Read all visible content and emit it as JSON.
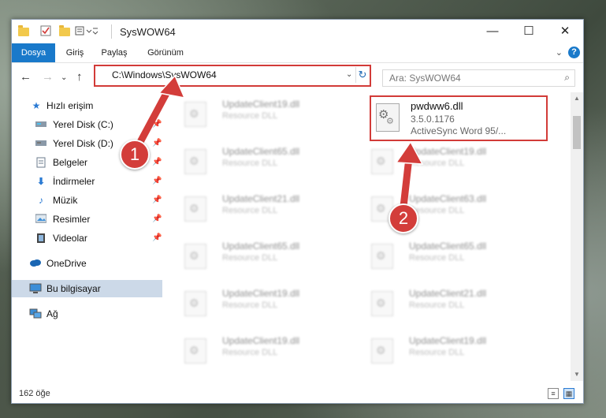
{
  "window": {
    "title": "SysWOW64",
    "controls": {
      "minimize": "—",
      "maximize": "☐",
      "close": "✕"
    }
  },
  "ribbon": {
    "tabs": [
      "Dosya",
      "Giriş",
      "Paylaş",
      "Görünüm"
    ],
    "active_tab": "Dosya",
    "help": "?"
  },
  "address": {
    "path": "C:\\Windows\\SysWOW64",
    "search_placeholder": "Ara: SysWOW64"
  },
  "sidebar": {
    "items": [
      {
        "label": "Hızlı erişim",
        "icon": "star-icon",
        "pinned": false
      },
      {
        "label": "Yerel Disk (C:)",
        "icon": "drive-icon",
        "pinned": true
      },
      {
        "label": "Yerel Disk (D:)",
        "icon": "drive-icon",
        "pinned": true
      },
      {
        "label": "Belgeler",
        "icon": "documents-icon",
        "pinned": true
      },
      {
        "label": "İndirmeler",
        "icon": "download-icon",
        "pinned": true
      },
      {
        "label": "Müzik",
        "icon": "music-icon",
        "pinned": true
      },
      {
        "label": "Resimler",
        "icon": "pictures-icon",
        "pinned": true
      },
      {
        "label": "Videolar",
        "icon": "videos-icon",
        "pinned": true
      },
      {
        "label": "OneDrive",
        "icon": "cloud-icon",
        "pinned": false
      },
      {
        "label": "Bu bilgisayar",
        "icon": "computer-icon",
        "pinned": false,
        "selected": true
      },
      {
        "label": "Ağ",
        "icon": "network-icon",
        "pinned": false
      }
    ]
  },
  "files": {
    "highlighted": {
      "name": "pwdww6.dll",
      "version": "3.5.0.1176",
      "description": "ActiveSync Word 95/..."
    },
    "left_column": [
      {
        "name": "UpdateClient19.dll",
        "type": "Resource DLL"
      },
      {
        "name": "UpdateClient65.dll",
        "type": "Resource DLL"
      },
      {
        "name": "UpdateClient21.dll",
        "type": "Resource DLL"
      },
      {
        "name": "UpdateClient65.dll",
        "type": "Resource DLL"
      },
      {
        "name": "UpdateClient19.dll",
        "type": "Resource DLL"
      },
      {
        "name": "UpdateClient19.dll",
        "type": "Resource DLL"
      }
    ],
    "right_column": [
      {
        "name": "UpdateClient19.dll",
        "type": "Resource DLL"
      },
      {
        "name": "UpdateClient63.dll",
        "type": "Resource DLL"
      },
      {
        "name": "UpdateClient65.dll",
        "type": "Resource DLL"
      },
      {
        "name": "UpdateClient21.dll",
        "type": "Resource DLL"
      },
      {
        "name": "UpdateClient19.dll",
        "type": "Resource DLL"
      }
    ]
  },
  "status": {
    "count": "162 öğe"
  },
  "annotations": {
    "step1": "1",
    "step2": "2",
    "color": "#d33d3a"
  }
}
